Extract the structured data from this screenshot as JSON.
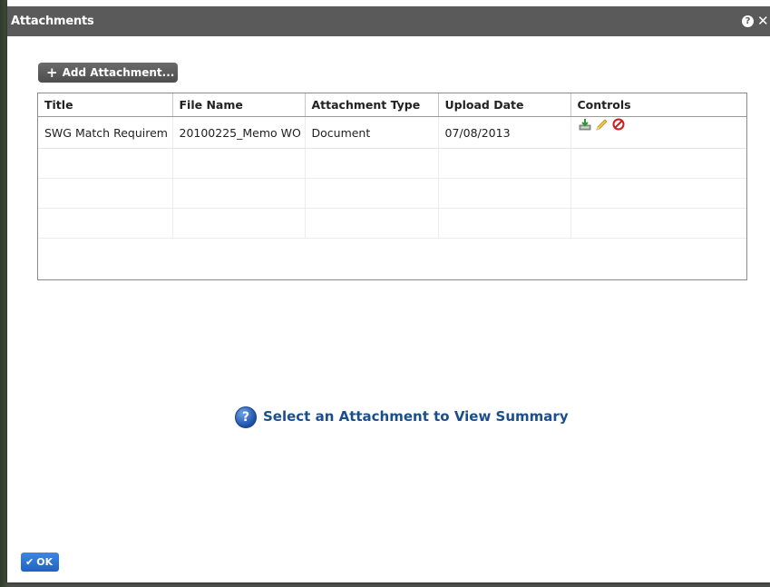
{
  "window": {
    "title": "Attachments",
    "help_icon": "help-icon",
    "close_icon": "close-icon"
  },
  "toolbar": {
    "add_label": "Add Attachment...",
    "add_icon": "plus-icon"
  },
  "grid": {
    "columns": [
      "Title",
      "File Name",
      "Attachment Type",
      "Upload Date",
      "Controls"
    ],
    "rows": [
      {
        "title": "SWG Match Requirem",
        "file_name": "20100225_Memo WO",
        "attachment_type": "Document",
        "upload_date": "07/08/2013",
        "controls": [
          "download-icon",
          "edit-icon",
          "delete-icon"
        ]
      }
    ]
  },
  "summary": {
    "text": "Select an Attachment to View Summary",
    "icon": "info-icon"
  },
  "footer": {
    "ok_label": "OK",
    "ok_icon": "check-icon"
  },
  "colors": {
    "titlebar": "#5a5a5a",
    "summary_text": "#1b4f8c",
    "ok_button": "#2b72d4",
    "delete_icon": "#d11a1a"
  }
}
